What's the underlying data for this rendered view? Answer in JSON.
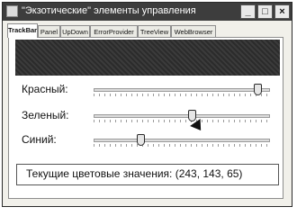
{
  "window": {
    "title": "\"Экзотические\" элементы управления"
  },
  "tabs": [
    {
      "label": "TrackBar"
    },
    {
      "label": "Panel"
    },
    {
      "label": "UpDown"
    },
    {
      "label": "ErrorProvider"
    },
    {
      "label": "TreeView"
    },
    {
      "label": "WebBrowser"
    }
  ],
  "trackbar_tab": {
    "color_preview": "#2b2b2b",
    "sliders": [
      {
        "label": "Красный:",
        "value": 243,
        "max": 255
      },
      {
        "label": "Зеленый:",
        "value": 143,
        "max": 255
      },
      {
        "label": "Синий:",
        "value": 65,
        "max": 255
      }
    ],
    "values_label": "Текущие цветовые значения: (243, 143, 65)"
  }
}
